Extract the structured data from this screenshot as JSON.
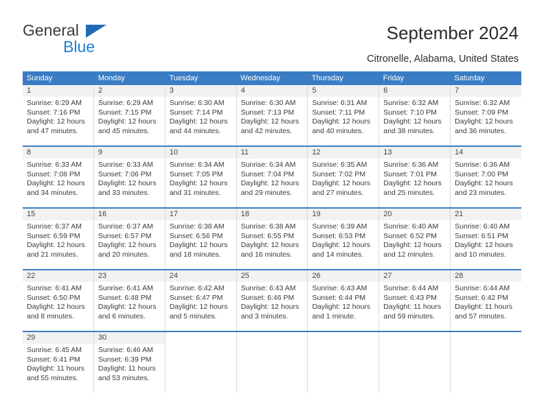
{
  "brand": {
    "name_part1": "General",
    "name_part2": "Blue",
    "triangle_color": "#1f6bb6",
    "blue_color": "#1f7fd4"
  },
  "header": {
    "title": "September 2024",
    "subtitle": "Citronelle, Alabama, United States"
  },
  "calendar": {
    "header_bg": "#3b7dc4",
    "weekdays": [
      "Sunday",
      "Monday",
      "Tuesday",
      "Wednesday",
      "Thursday",
      "Friday",
      "Saturday"
    ],
    "weeks": [
      [
        {
          "day": "1",
          "sunrise": "Sunrise: 6:29 AM",
          "sunset": "Sunset: 7:16 PM",
          "daylight1": "Daylight: 12 hours",
          "daylight2": "and 47 minutes."
        },
        {
          "day": "2",
          "sunrise": "Sunrise: 6:29 AM",
          "sunset": "Sunset: 7:15 PM",
          "daylight1": "Daylight: 12 hours",
          "daylight2": "and 45 minutes."
        },
        {
          "day": "3",
          "sunrise": "Sunrise: 6:30 AM",
          "sunset": "Sunset: 7:14 PM",
          "daylight1": "Daylight: 12 hours",
          "daylight2": "and 44 minutes."
        },
        {
          "day": "4",
          "sunrise": "Sunrise: 6:30 AM",
          "sunset": "Sunset: 7:13 PM",
          "daylight1": "Daylight: 12 hours",
          "daylight2": "and 42 minutes."
        },
        {
          "day": "5",
          "sunrise": "Sunrise: 6:31 AM",
          "sunset": "Sunset: 7:11 PM",
          "daylight1": "Daylight: 12 hours",
          "daylight2": "and 40 minutes."
        },
        {
          "day": "6",
          "sunrise": "Sunrise: 6:32 AM",
          "sunset": "Sunset: 7:10 PM",
          "daylight1": "Daylight: 12 hours",
          "daylight2": "and 38 minutes."
        },
        {
          "day": "7",
          "sunrise": "Sunrise: 6:32 AM",
          "sunset": "Sunset: 7:09 PM",
          "daylight1": "Daylight: 12 hours",
          "daylight2": "and 36 minutes."
        }
      ],
      [
        {
          "day": "8",
          "sunrise": "Sunrise: 6:33 AM",
          "sunset": "Sunset: 7:08 PM",
          "daylight1": "Daylight: 12 hours",
          "daylight2": "and 34 minutes."
        },
        {
          "day": "9",
          "sunrise": "Sunrise: 6:33 AM",
          "sunset": "Sunset: 7:06 PM",
          "daylight1": "Daylight: 12 hours",
          "daylight2": "and 33 minutes."
        },
        {
          "day": "10",
          "sunrise": "Sunrise: 6:34 AM",
          "sunset": "Sunset: 7:05 PM",
          "daylight1": "Daylight: 12 hours",
          "daylight2": "and 31 minutes."
        },
        {
          "day": "11",
          "sunrise": "Sunrise: 6:34 AM",
          "sunset": "Sunset: 7:04 PM",
          "daylight1": "Daylight: 12 hours",
          "daylight2": "and 29 minutes."
        },
        {
          "day": "12",
          "sunrise": "Sunrise: 6:35 AM",
          "sunset": "Sunset: 7:02 PM",
          "daylight1": "Daylight: 12 hours",
          "daylight2": "and 27 minutes."
        },
        {
          "day": "13",
          "sunrise": "Sunrise: 6:36 AM",
          "sunset": "Sunset: 7:01 PM",
          "daylight1": "Daylight: 12 hours",
          "daylight2": "and 25 minutes."
        },
        {
          "day": "14",
          "sunrise": "Sunrise: 6:36 AM",
          "sunset": "Sunset: 7:00 PM",
          "daylight1": "Daylight: 12 hours",
          "daylight2": "and 23 minutes."
        }
      ],
      [
        {
          "day": "15",
          "sunrise": "Sunrise: 6:37 AM",
          "sunset": "Sunset: 6:59 PM",
          "daylight1": "Daylight: 12 hours",
          "daylight2": "and 21 minutes."
        },
        {
          "day": "16",
          "sunrise": "Sunrise: 6:37 AM",
          "sunset": "Sunset: 6:57 PM",
          "daylight1": "Daylight: 12 hours",
          "daylight2": "and 20 minutes."
        },
        {
          "day": "17",
          "sunrise": "Sunrise: 6:38 AM",
          "sunset": "Sunset: 6:56 PM",
          "daylight1": "Daylight: 12 hours",
          "daylight2": "and 18 minutes."
        },
        {
          "day": "18",
          "sunrise": "Sunrise: 6:38 AM",
          "sunset": "Sunset: 6:55 PM",
          "daylight1": "Daylight: 12 hours",
          "daylight2": "and 16 minutes."
        },
        {
          "day": "19",
          "sunrise": "Sunrise: 6:39 AM",
          "sunset": "Sunset: 6:53 PM",
          "daylight1": "Daylight: 12 hours",
          "daylight2": "and 14 minutes."
        },
        {
          "day": "20",
          "sunrise": "Sunrise: 6:40 AM",
          "sunset": "Sunset: 6:52 PM",
          "daylight1": "Daylight: 12 hours",
          "daylight2": "and 12 minutes."
        },
        {
          "day": "21",
          "sunrise": "Sunrise: 6:40 AM",
          "sunset": "Sunset: 6:51 PM",
          "daylight1": "Daylight: 12 hours",
          "daylight2": "and 10 minutes."
        }
      ],
      [
        {
          "day": "22",
          "sunrise": "Sunrise: 6:41 AM",
          "sunset": "Sunset: 6:50 PM",
          "daylight1": "Daylight: 12 hours",
          "daylight2": "and 8 minutes."
        },
        {
          "day": "23",
          "sunrise": "Sunrise: 6:41 AM",
          "sunset": "Sunset: 6:48 PM",
          "daylight1": "Daylight: 12 hours",
          "daylight2": "and 6 minutes."
        },
        {
          "day": "24",
          "sunrise": "Sunrise: 6:42 AM",
          "sunset": "Sunset: 6:47 PM",
          "daylight1": "Daylight: 12 hours",
          "daylight2": "and 5 minutes."
        },
        {
          "day": "25",
          "sunrise": "Sunrise: 6:43 AM",
          "sunset": "Sunset: 6:46 PM",
          "daylight1": "Daylight: 12 hours",
          "daylight2": "and 3 minutes."
        },
        {
          "day": "26",
          "sunrise": "Sunrise: 6:43 AM",
          "sunset": "Sunset: 6:44 PM",
          "daylight1": "Daylight: 12 hours",
          "daylight2": "and 1 minute."
        },
        {
          "day": "27",
          "sunrise": "Sunrise: 6:44 AM",
          "sunset": "Sunset: 6:43 PM",
          "daylight1": "Daylight: 11 hours",
          "daylight2": "and 59 minutes."
        },
        {
          "day": "28",
          "sunrise": "Sunrise: 6:44 AM",
          "sunset": "Sunset: 6:42 PM",
          "daylight1": "Daylight: 11 hours",
          "daylight2": "and 57 minutes."
        }
      ],
      [
        {
          "day": "29",
          "sunrise": "Sunrise: 6:45 AM",
          "sunset": "Sunset: 6:41 PM",
          "daylight1": "Daylight: 11 hours",
          "daylight2": "and 55 minutes."
        },
        {
          "day": "30",
          "sunrise": "Sunrise: 6:46 AM",
          "sunset": "Sunset: 6:39 PM",
          "daylight1": "Daylight: 11 hours",
          "daylight2": "and 53 minutes."
        },
        {
          "day": "",
          "sunrise": "",
          "sunset": "",
          "daylight1": "",
          "daylight2": ""
        },
        {
          "day": "",
          "sunrise": "",
          "sunset": "",
          "daylight1": "",
          "daylight2": ""
        },
        {
          "day": "",
          "sunrise": "",
          "sunset": "",
          "daylight1": "",
          "daylight2": ""
        },
        {
          "day": "",
          "sunrise": "",
          "sunset": "",
          "daylight1": "",
          "daylight2": ""
        },
        {
          "day": "",
          "sunrise": "",
          "sunset": "",
          "daylight1": "",
          "daylight2": ""
        }
      ]
    ]
  }
}
